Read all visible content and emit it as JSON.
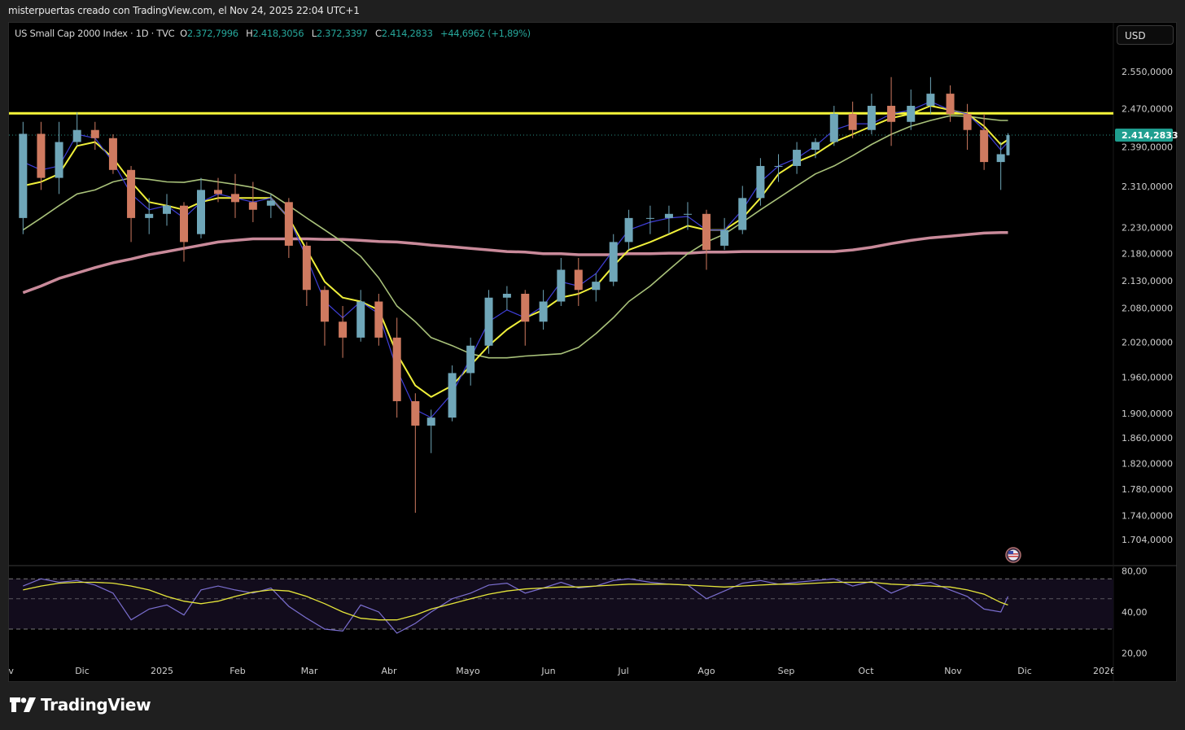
{
  "header": {
    "attribution": "misterpuertas creado con TradingView.com, el Nov 24, 2025 22:04 UTC+1"
  },
  "legend": {
    "symbol": "US Small Cap 2000 Index · 1D · TVC",
    "open_label": "O",
    "open": "2.372,7996",
    "high_label": "H",
    "high": "2.418,3056",
    "low_label": "L",
    "low": "2.372,3397",
    "close_label": "C",
    "close": "2.414,2833",
    "change": "+44,6962 (+1,89%)"
  },
  "currency_button": "USD",
  "last_price_label": "2.414,2833",
  "brand": "TradingView",
  "colors": {
    "up": "#6fa6b8",
    "down": "#cf7a60",
    "ema_fast": "#3f3fd8",
    "ema_mid": "#f0f03a",
    "sma_50": "#a9c27a",
    "sma_200": "#c98a9a",
    "resistance": "#f5f53a",
    "last_price": "#1f9e8f",
    "rsi": "#7b6fd0",
    "rsi_ma": "#e6e63a",
    "rsi_band": "#120c1c"
  },
  "icons": {
    "event_marker": "us-flag-icon",
    "logo": "tradingview-logo-icon"
  },
  "chart_data": {
    "type": "candlestick",
    "title": "US Small Cap 2000 Index · 1D · TVC",
    "scale": "log",
    "ylim": [
      1690,
      2580
    ],
    "grid": false,
    "price_ticks": [
      {
        "label": "2.550,0000",
        "value": 2550
      },
      {
        "label": "2.470,0000",
        "value": 2470
      },
      {
        "label": "2.390,0000",
        "value": 2390
      },
      {
        "label": "2.310,0000",
        "value": 2310
      },
      {
        "label": "2.230,0000",
        "value": 2230
      },
      {
        "label": "2.180,0000",
        "value": 2180
      },
      {
        "label": "2.130,0000",
        "value": 2130
      },
      {
        "label": "2.080,0000",
        "value": 2080
      },
      {
        "label": "2.020,0000",
        "value": 2020
      },
      {
        "label": "1.960,0000",
        "value": 1960
      },
      {
        "label": "1.900,0000",
        "value": 1900
      },
      {
        "label": "1.860,0000",
        "value": 1860
      },
      {
        "label": "1.820,0000",
        "value": 1820
      },
      {
        "label": "1.780,0000",
        "value": 1780
      },
      {
        "label": "1.740,0000",
        "value": 1740
      },
      {
        "label": "1.704,0000",
        "value": 1704
      }
    ],
    "time_ticks": [
      {
        "label": "Nov",
        "date": "2024-11-01"
      },
      {
        "label": "Dic",
        "date": "2024-12-01"
      },
      {
        "label": "2025",
        "date": "2025-01-01"
      },
      {
        "label": "Feb",
        "date": "2025-02-01"
      },
      {
        "label": "Mar",
        "date": "2025-03-01"
      },
      {
        "label": "Abr",
        "date": "2025-04-01"
      },
      {
        "label": "Mayo",
        "date": "2025-05-01"
      },
      {
        "label": "Jun",
        "date": "2025-06-01"
      },
      {
        "label": "Jul",
        "date": "2025-07-01"
      },
      {
        "label": "Ago",
        "date": "2025-08-01"
      },
      {
        "label": "Sep",
        "date": "2025-09-01"
      },
      {
        "label": "Oct",
        "date": "2025-10-01"
      },
      {
        "label": "Nov",
        "date": "2025-11-01"
      },
      {
        "label": "Dic",
        "date": "2025-12-01"
      },
      {
        "label": "2026",
        "date": "2026-01-01"
      }
    ],
    "dates": [
      "2024-11-08",
      "2024-11-15",
      "2024-11-22",
      "2024-11-29",
      "2024-12-06",
      "2024-12-13",
      "2024-12-20",
      "2024-12-27",
      "2025-01-03",
      "2025-01-10",
      "2025-01-17",
      "2025-01-24",
      "2025-01-31",
      "2025-02-07",
      "2025-02-14",
      "2025-02-21",
      "2025-02-28",
      "2025-03-07",
      "2025-03-14",
      "2025-03-21",
      "2025-03-28",
      "2025-04-04",
      "2025-04-11",
      "2025-04-17",
      "2025-04-25",
      "2025-05-02",
      "2025-05-09",
      "2025-05-16",
      "2025-05-23",
      "2025-05-30",
      "2025-06-06",
      "2025-06-13",
      "2025-06-20",
      "2025-06-27",
      "2025-07-03",
      "2025-07-11",
      "2025-07-18",
      "2025-07-25",
      "2025-08-01",
      "2025-08-08",
      "2025-08-15",
      "2025-08-22",
      "2025-08-29",
      "2025-09-05",
      "2025-09-12",
      "2025-09-19",
      "2025-09-26",
      "2025-10-03",
      "2025-10-10",
      "2025-10-17",
      "2025-10-24",
      "2025-10-31",
      "2025-11-07",
      "2025-11-14",
      "2025-11-21",
      "2025-11-24"
    ],
    "ohlc": [
      [
        2248,
        2442,
        2217,
        2417
      ],
      [
        2417,
        2442,
        2303,
        2327
      ],
      [
        2327,
        2442,
        2295,
        2400
      ],
      [
        2400,
        2462,
        2392,
        2425
      ],
      [
        2425,
        2442,
        2384,
        2408
      ],
      [
        2408,
        2416,
        2335,
        2343
      ],
      [
        2343,
        2351,
        2202,
        2248
      ],
      [
        2248,
        2287,
        2217,
        2256
      ],
      [
        2256,
        2295,
        2233,
        2272
      ],
      [
        2272,
        2279,
        2165,
        2202
      ],
      [
        2217,
        2327,
        2209,
        2303
      ],
      [
        2303,
        2327,
        2279,
        2295
      ],
      [
        2295,
        2335,
        2248,
        2279
      ],
      [
        2279,
        2319,
        2240,
        2264
      ],
      [
        2272,
        2295,
        2248,
        2282
      ],
      [
        2279,
        2287,
        2172,
        2195
      ],
      [
        2195,
        2202,
        2084,
        2113
      ],
      [
        2113,
        2120,
        2014,
        2056
      ],
      [
        2056,
        2084,
        1993,
        2028
      ],
      [
        2028,
        2113,
        2021,
        2092
      ],
      [
        2092,
        2106,
        2014,
        2028
      ],
      [
        2028,
        2063,
        1893,
        1920
      ],
      [
        1920,
        1933,
        1744,
        1880
      ],
      [
        1880,
        1906,
        1836,
        1893
      ],
      [
        1893,
        1980,
        1887,
        1967
      ],
      [
        1967,
        2028,
        1946,
        2014
      ],
      [
        2014,
        2113,
        2000,
        2099
      ],
      [
        2099,
        2120,
        2077,
        2106
      ],
      [
        2106,
        2113,
        2014,
        2056
      ],
      [
        2056,
        2113,
        2042,
        2092
      ],
      [
        2092,
        2172,
        2084,
        2150
      ],
      [
        2150,
        2172,
        2084,
        2113
      ],
      [
        2113,
        2143,
        2092,
        2128
      ],
      [
        2128,
        2217,
        2120,
        2202
      ],
      [
        2202,
        2264,
        2187,
        2248
      ],
      [
        2248,
        2272,
        2217,
        2248
      ],
      [
        2248,
        2272,
        2217,
        2256
      ],
      [
        2256,
        2279,
        2225,
        2256
      ],
      [
        2256,
        2264,
        2150,
        2187
      ],
      [
        2195,
        2248,
        2187,
        2225
      ],
      [
        2225,
        2311,
        2217,
        2287
      ],
      [
        2287,
        2367,
        2272,
        2351
      ],
      [
        2351,
        2375,
        2319,
        2351
      ],
      [
        2351,
        2400,
        2335,
        2384
      ],
      [
        2384,
        2408,
        2367,
        2400
      ],
      [
        2400,
        2476,
        2392,
        2459
      ],
      [
        2459,
        2485,
        2408,
        2425
      ],
      [
        2425,
        2502,
        2416,
        2476
      ],
      [
        2476,
        2538,
        2392,
        2442
      ],
      [
        2442,
        2511,
        2425,
        2476
      ],
      [
        2476,
        2538,
        2459,
        2502
      ],
      [
        2502,
        2520,
        2442,
        2459
      ],
      [
        2459,
        2480,
        2384,
        2425
      ],
      [
        2425,
        2459,
        2343,
        2359
      ],
      [
        2359,
        2400,
        2303,
        2375
      ],
      [
        2372.7996,
        2418.3056,
        2372.3397,
        2414.2833
      ]
    ],
    "last_price": 2414.2833,
    "resistance_level": 2460,
    "moving_averages": [
      {
        "key": "ema_fast",
        "values": [
          2359,
          2343,
          2351,
          2416,
          2408,
          2359,
          2295,
          2264,
          2272,
          2248,
          2279,
          2295,
          2287,
          2279,
          2287,
          2248,
          2172,
          2092,
          2063,
          2092,
          2070,
          1973,
          1906,
          1893,
          1933,
          1993,
          2056,
          2077,
          2063,
          2084,
          2128,
          2120,
          2143,
          2187,
          2225,
          2240,
          2248,
          2251,
          2225,
          2225,
          2264,
          2319,
          2351,
          2367,
          2392,
          2425,
          2438,
          2438,
          2459,
          2467,
          2485,
          2467,
          2459,
          2425,
          2384,
          2400
        ]
      },
      {
        "key": "ema_mid",
        "values": [
          2311,
          2319,
          2335,
          2392,
          2400,
          2367,
          2319,
          2279,
          2272,
          2264,
          2279,
          2287,
          2287,
          2287,
          2287,
          2248,
          2187,
          2128,
          2099,
          2092,
          2077,
          2000,
          1946,
          1927,
          1946,
          1980,
          2014,
          2042,
          2063,
          2077,
          2099,
          2106,
          2120,
          2157,
          2187,
          2202,
          2217,
          2233,
          2225,
          2225,
          2248,
          2287,
          2335,
          2359,
          2375,
          2400,
          2416,
          2433,
          2450,
          2459,
          2476,
          2467,
          2459,
          2433,
          2395,
          2405
        ]
      },
      {
        "key": "sma_50",
        "values": [
          2225,
          2248,
          2272,
          2295,
          2303,
          2319,
          2327,
          2324,
          2319,
          2318,
          2324,
          2319,
          2314,
          2308,
          2295,
          2272,
          2248,
          2225,
          2202,
          2175,
          2135,
          2084,
          2056,
          2028,
          2014,
          2000,
          1993,
          1993,
          1996,
          1998,
          2000,
          2011,
          2035,
          2063,
          2092,
          2120,
          2150,
          2180,
          2202,
          2217,
          2240,
          2264,
          2287,
          2311,
          2335,
          2351,
          2372,
          2395,
          2416,
          2433,
          2445,
          2455,
          2454,
          2449,
          2445,
          2445
        ]
      },
      {
        "key": "sma_200",
        "values": [
          2108,
          2120,
          2134,
          2144,
          2154,
          2163,
          2170,
          2178,
          2184,
          2190,
          2196,
          2202,
          2205,
          2208,
          2208,
          2208,
          2208,
          2207,
          2207,
          2205,
          2203,
          2202,
          2199,
          2196,
          2193,
          2190,
          2187,
          2184,
          2183,
          2180,
          2180,
          2178,
          2178,
          2178,
          2180,
          2180,
          2181,
          2181,
          2183,
          2183,
          2184,
          2184,
          2184,
          2184,
          2184,
          2184,
          2187,
          2192,
          2199,
          2205,
          2210,
          2213,
          2216,
          2219,
          2220,
          2220
        ]
      }
    ],
    "rsi": {
      "scale": "log",
      "ticks": [
        {
          "label": "80,00",
          "value": 80
        },
        {
          "label": "40,00",
          "value": 40
        },
        {
          "label": "20,00",
          "value": 20
        }
      ],
      "levels": [
        70,
        50,
        30
      ],
      "values": [
        62,
        70,
        66,
        68,
        63,
        55,
        35,
        42,
        45,
        38,
        58,
        62,
        58,
        55,
        60,
        44,
        36,
        30,
        29,
        45,
        40,
        28,
        33,
        40,
        50,
        55,
        63,
        65,
        55,
        60,
        66,
        60,
        62,
        68,
        70,
        66,
        64,
        63,
        50,
        57,
        65,
        68,
        64,
        66,
        68,
        70,
        62,
        67,
        55,
        63,
        66,
        58,
        52,
        42,
        40,
        52
      ],
      "ma_values": [
        58,
        62,
        65,
        66,
        66,
        65,
        62,
        58,
        52,
        48,
        46,
        48,
        52,
        56,
        58,
        57,
        52,
        46,
        40,
        36,
        35,
        35,
        38,
        42,
        46,
        50,
        54,
        57,
        59,
        60,
        61,
        61,
        62,
        63,
        64,
        64,
        64,
        63,
        62,
        61,
        62,
        63,
        64,
        64,
        65,
        66,
        66,
        66,
        64,
        63,
        62,
        61,
        58,
        54,
        47,
        45
      ]
    }
  }
}
